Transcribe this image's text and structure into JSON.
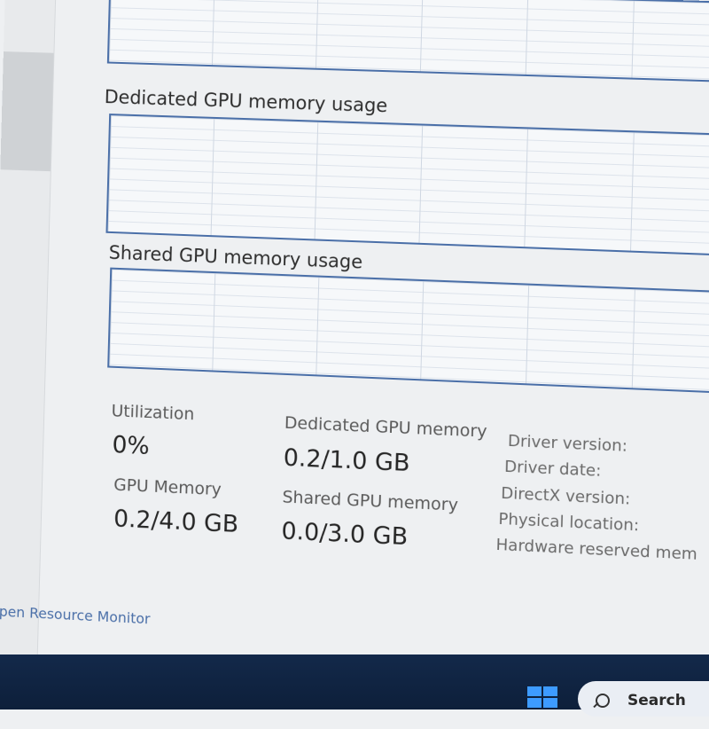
{
  "graphs": {
    "dedicated_label": "Dedicated GPU memory usage",
    "shared_label": "Shared GPU memory usage"
  },
  "stats": {
    "utilization_label": "Utilization",
    "utilization_value": "0%",
    "dedicated_label": "Dedicated GPU memory",
    "dedicated_value": "0.2/1.0 GB",
    "gpu_memory_label": "GPU Memory",
    "gpu_memory_value": "0.2/4.0 GB",
    "shared_label": "Shared GPU memory",
    "shared_value": "0.0/3.0 GB"
  },
  "info": {
    "driver_version": "Driver version:",
    "driver_date": "Driver date:",
    "directx_version": "DirectX version:",
    "physical_location": "Physical location:",
    "hardware_reserved": "Hardware reserved mem"
  },
  "footer": {
    "open_resource_monitor": "Open Resource Monitor"
  },
  "taskbar": {
    "search_label": "Search"
  },
  "colors": {
    "graph_border": "#4a6fa8",
    "taskbar": "#13294a",
    "accent": "#3d9bff"
  }
}
